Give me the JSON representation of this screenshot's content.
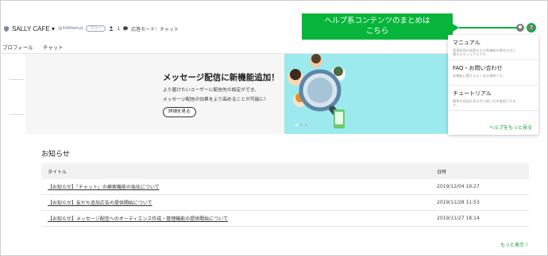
{
  "header": {
    "account_name": "SALLY CAFE ▾",
    "account_id": "@446fwfud",
    "plan_badge": "フリー",
    "member_count": "1",
    "response_mode": "応答モード：チャット"
  },
  "nav": {
    "items": [
      "プロフィール",
      "チャット"
    ]
  },
  "banner": {
    "title": "メッセージ配信に新機能追加！",
    "body": "より届けたいユーザーに配信先の設定ができ、\nメッセージ配信の効果をより高めることが可能に！",
    "button": "詳細を見る"
  },
  "tooltip": {
    "text": "ヘルプ系コンテンツのまとめは\nこちら"
  },
  "help_menu": {
    "items": [
      {
        "title": "マニュアル",
        "desc": "管理画面の画面および各機能の操作方法に\n関するマニュアルです。"
      },
      {
        "title": "FAQ・お問い合わせ",
        "desc": "各機能に関するよくある質問です。"
      },
      {
        "title": "チュートリアル",
        "desc": "簡単の画面を見ながら使い方を確認できま\nす。"
      }
    ],
    "more": "ヘルプをもっと見る"
  },
  "news": {
    "title": "お知らせ",
    "columns": [
      "タイトル",
      "日時"
    ],
    "rows": [
      {
        "title": "【お知らせ】「チャット」の検索機能の強化について",
        "date": "2019/12/04 19:27"
      },
      {
        "title": "【お知らせ】友だち追加広告の提供開始について",
        "date": "2019/11/28 11:53"
      },
      {
        "title": "【お知らせ】メッセージ配信へのオーディエンス作成・管理機能の提供開始について",
        "date": "2019/11/27 18:14"
      }
    ],
    "more": "もっと表示 〉"
  },
  "colors": {
    "accent": "#07b53b",
    "link_green": "#0d9f2e",
    "banner_cyan": "#9ceaee"
  },
  "icons": [
    "shield-icon",
    "member-icon",
    "chat-mode-icon",
    "profile-icon",
    "help-icon"
  ]
}
